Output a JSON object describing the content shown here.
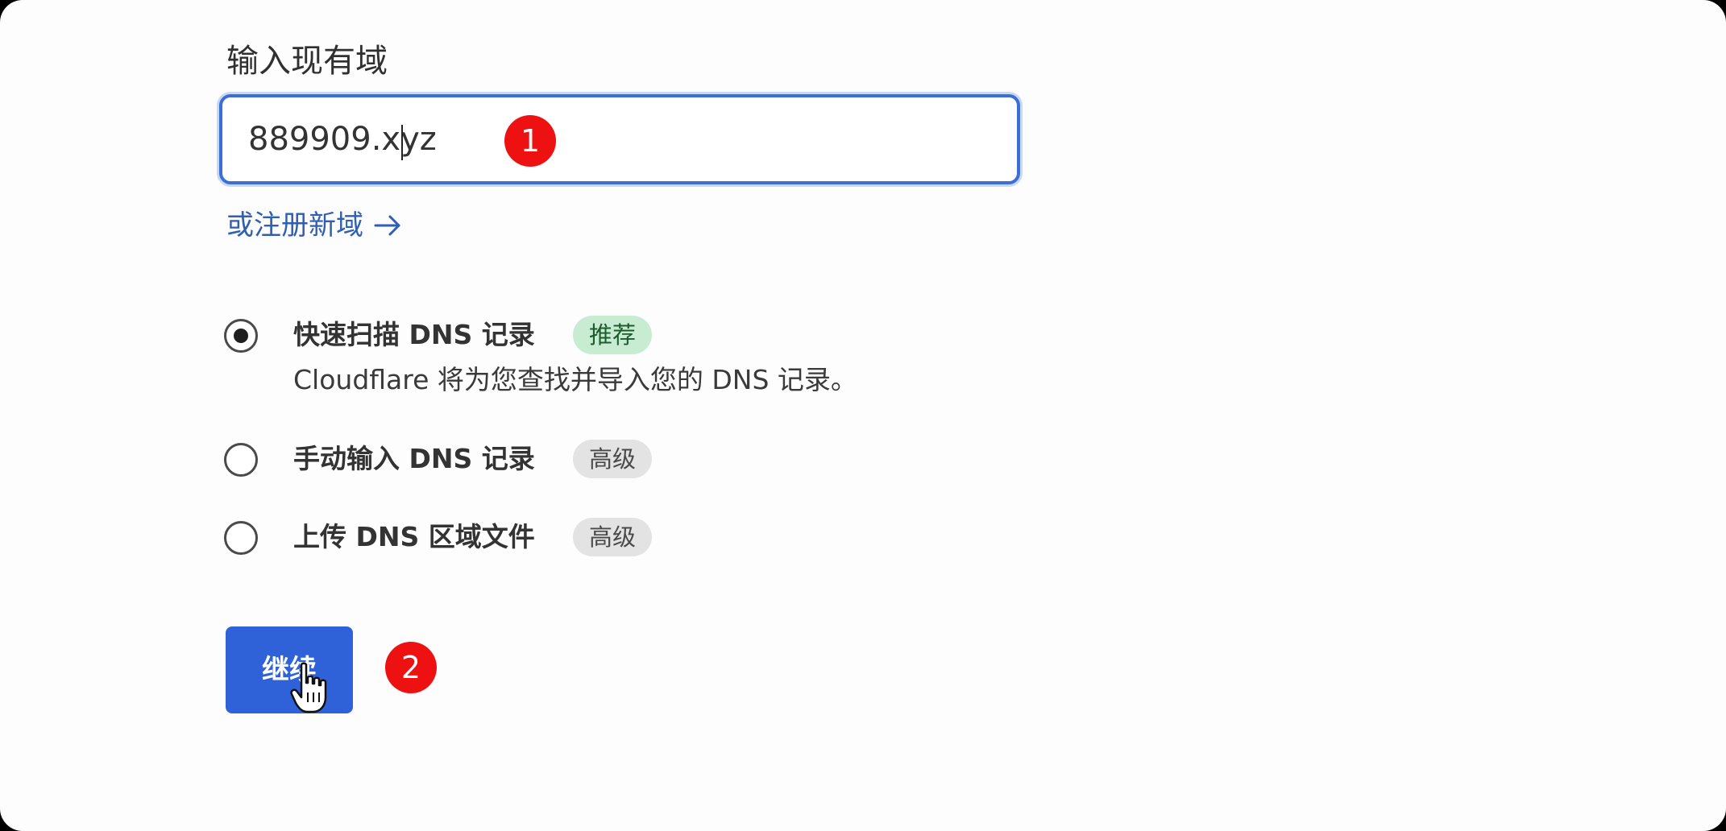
{
  "form": {
    "label": "输入现有域",
    "input_value": "889909.xyz",
    "register_link": "或注册新域",
    "register_icon": "arrow-right-icon"
  },
  "steps": {
    "step1": "1",
    "step2": "2"
  },
  "options": [
    {
      "title": "快速扫描 DNS 记录",
      "tag": "推荐",
      "description": "Cloudflare 将为您查找并导入您的 DNS 记录。",
      "selected": true
    },
    {
      "title": "手动输入 DNS 记录",
      "tag": "高级",
      "selected": false
    },
    {
      "title": "上传 DNS 区域文件",
      "tag": "高级",
      "selected": false
    }
  ],
  "actions": {
    "continue_label": "继续"
  },
  "colors": {
    "accent": "#2f62d8",
    "link": "#2f5fb3",
    "step_badge": "#ee1111",
    "recommended_tag_bg": "#c8ecd2",
    "advanced_tag_bg": "#e3e3e3"
  },
  "cursor": "hand-pointer-icon"
}
